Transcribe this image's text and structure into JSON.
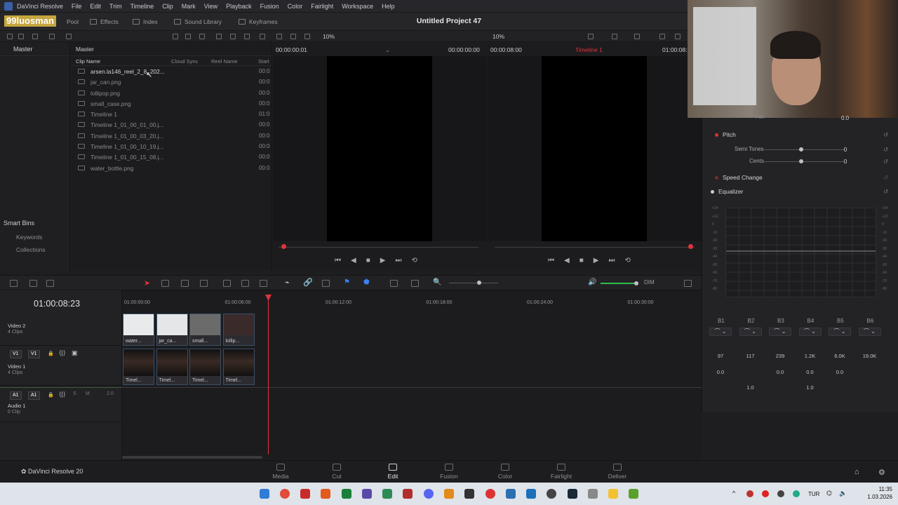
{
  "menubar": {
    "app_name": "DaVinci Resolve",
    "items": [
      "File",
      "Edit",
      "Trim",
      "Timeline",
      "Clip",
      "Mark",
      "View",
      "Playback",
      "Fusion",
      "Color",
      "Fairlight",
      "Workspace",
      "Help"
    ]
  },
  "toolbar": {
    "watermark": "99luosman",
    "media_pool_suffix": "Pool",
    "effects": "Effects",
    "index": "Index",
    "sound_library": "Sound Library",
    "keyframes": "Keyframes",
    "project_title": "Untitled Project 47"
  },
  "subbar": {
    "zoom_left": "10%",
    "zoom_right": "10%"
  },
  "bins": {
    "master": "Master",
    "smart_bins": "Smart Bins",
    "keywords": "Keywords",
    "collections": "Collections"
  },
  "media_pool": {
    "header": "Master",
    "columns": {
      "clip_name": "Clip Name",
      "cloud_sync": "Cloud Sync",
      "reel_name": "Reel Name",
      "start": "Start"
    },
    "clips": [
      {
        "name": "arsen.la146_reel_2_8_202...",
        "start": "00:0"
      },
      {
        "name": "jar_can.png",
        "start": "00:0"
      },
      {
        "name": "lollipop.png",
        "start": "00:0"
      },
      {
        "name": "small_case.png",
        "start": "00:0"
      },
      {
        "name": "Timeline 1",
        "start": "01:0"
      },
      {
        "name": "Timeline 1_01_00_01_00.j...",
        "start": "00:0"
      },
      {
        "name": "Timeline 1_01_00_03_20.j...",
        "start": "00:0"
      },
      {
        "name": "Timeline 1_01_00_10_19.j...",
        "start": "00:0"
      },
      {
        "name": "Timeline 1_01_00_15_08.j...",
        "start": "00:0"
      },
      {
        "name": "water_bottle.png",
        "start": "00:0"
      }
    ]
  },
  "viewers": {
    "source_tc_left": "00:00:00:01",
    "source_tc_right": "00:00:00:00",
    "timeline_tc_left": "00:00:08:00",
    "timeline_name": "Timeline 1",
    "timeline_tc_right": "01:00:08:"
  },
  "inspector": {
    "pan_label": "Pan",
    "pan_value": "0.0",
    "pitch": "Pitch",
    "semitones_label": "Semi Tones",
    "semitones_value": "0",
    "cents_label": "Cents",
    "cents_value": "0",
    "speed_change": "Speed Change",
    "equalizer": "Equalizer",
    "eq_scale": [
      "+24",
      "+12",
      "0",
      "-10",
      "-20",
      "-30",
      "-40",
      "-50",
      "-60",
      "-70",
      "-80"
    ],
    "bands": [
      "B1",
      "B2",
      "B3",
      "B4",
      "B5",
      "B6"
    ],
    "freq": [
      "97",
      "117",
      "239",
      "1.2K",
      "6.0K",
      "19.0K"
    ],
    "gain": [
      "0.0",
      "",
      "0.0",
      "0.0",
      "0.0",
      ""
    ],
    "q": [
      "",
      "1.0",
      "",
      "1.0",
      "",
      ""
    ]
  },
  "timeline": {
    "timecode": "01:00:08:23",
    "ruler": [
      "01:00:00:00",
      "01:00:06:00",
      "01:00:12:00",
      "01:00:18:00",
      "01:00:24:00",
      "01:00:30:00"
    ],
    "tracks": [
      {
        "name": "Video 2",
        "count": "4 Clips"
      },
      {
        "name": "Video 1",
        "count": "4 Clips",
        "tag": "V1"
      },
      {
        "name": "Audio 1",
        "count": "0 Clip",
        "tag": "A1",
        "channels": "2.0"
      }
    ],
    "v2_clips": [
      "water...",
      "jar_ca...",
      "small...",
      "lollip..."
    ],
    "v1_clips": [
      "Timel...",
      "Timel...",
      "Timel...",
      "Timel..."
    ],
    "dim": "DIM"
  },
  "pages": {
    "brand": "DaVinci Resolve 20",
    "tabs": [
      "Media",
      "Cut",
      "Edit",
      "Fusion",
      "Color",
      "Fairlight",
      "Deliver"
    ],
    "active": "Edit"
  },
  "taskbar": {
    "lang": "TUR",
    "time": "11:35",
    "date": "1.03.2026"
  },
  "colors": {
    "accent_red": "#e0333a",
    "active_tab": "#e8e8eb",
    "playhead": "#e0333a"
  }
}
